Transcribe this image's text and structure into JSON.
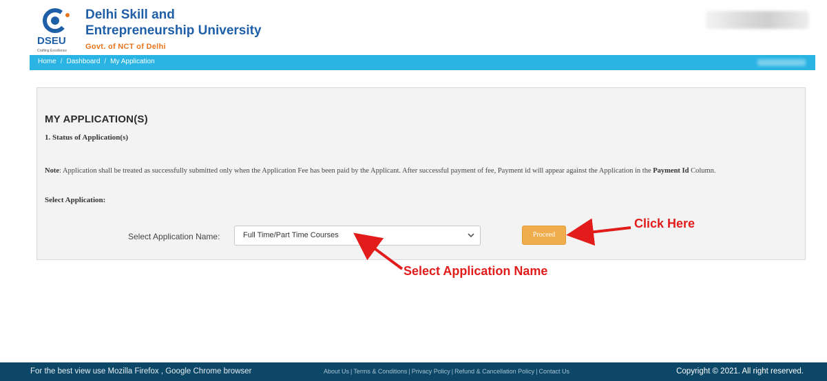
{
  "header": {
    "logo_abbr": "DSEU",
    "logo_tagline": "Crafting Excellence",
    "title_line1": "Delhi Skill and",
    "title_line2": "Entrepreneurship University",
    "subtitle": "Govt. of NCT of Delhi"
  },
  "breadcrumb": {
    "items": [
      "Home",
      "Dashboard",
      "My Application"
    ],
    "separator": "/"
  },
  "main": {
    "title": "MY APPLICATION(S)",
    "status_heading": "1. Status of Application(s)",
    "note_label": "Note",
    "note_text": ": Application shall be treated as successfully submitted only when the Application Fee has been paid by the Applicant. After successful payment of fee, Payment id will appear against the Application in the",
    "note_bold_tail": "Payment Id",
    "note_tail": " Column.",
    "select_application_heading": "Select Application:",
    "form": {
      "label": "Select Application Name:",
      "selected_value": "Full Time/Part Time Courses",
      "proceed_label": "Proceed"
    }
  },
  "annotations": {
    "click_here": "Click Here",
    "select_app_name": "Select Application Name"
  },
  "footer": {
    "browser_note": "For the best view use Mozilla Firefox , Google Chrome browser",
    "links": [
      "About Us",
      "Terms & Conditions",
      "Privacy Policy",
      "Refund & Cancellation Policy",
      "Contact Us"
    ],
    "copyright": "Copyright © 2021. All right reserved."
  },
  "colors": {
    "brand_blue": "#1f5fa8",
    "breadcrumb_bar": "#29b4e3",
    "proceed_button": "#f0ad4e",
    "footer_bg": "#0c4768",
    "annotation_red": "#e21b1b"
  }
}
